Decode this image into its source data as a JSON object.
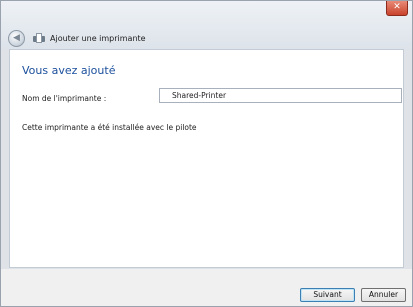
{
  "window": {
    "title": "Ajouter une imprimante",
    "close_glyph": "✕"
  },
  "nav": {
    "back_icon": "back-arrow-icon",
    "printer_icon": "printer-icon"
  },
  "main": {
    "heading": "Vous avez ajouté",
    "name_label": "Nom de l'imprimante :",
    "name_value": "Shared-Printer",
    "installed_text": "Cette imprimante a été installée avec le pilote"
  },
  "footer": {
    "next_label": "Suivant",
    "cancel_label": "Annuler"
  },
  "colors": {
    "heading": "#1b4f9c",
    "close": "#c9432b"
  }
}
